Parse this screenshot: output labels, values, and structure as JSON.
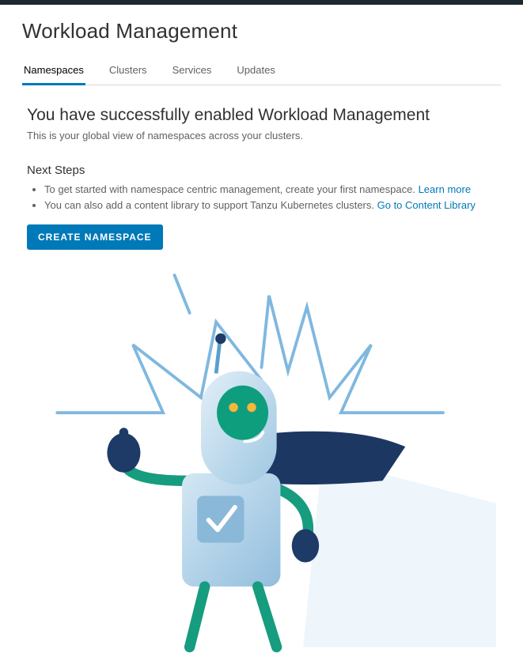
{
  "header": {
    "title": "Workload Management"
  },
  "tabs": [
    {
      "label": "Namespaces",
      "active": true
    },
    {
      "label": "Clusters",
      "active": false
    },
    {
      "label": "Services",
      "active": false
    },
    {
      "label": "Updates",
      "active": false
    }
  ],
  "content": {
    "success_heading": "You have successfully enabled Workload Management",
    "subheading": "This is your global view of namespaces across your clusters.",
    "next_steps_title": "Next Steps",
    "steps": [
      {
        "text": "To get started with namespace centric management, create your first namespace.",
        "link_label": "Learn more"
      },
      {
        "text": "You can also add a content library to support Tanzu Kubernetes clusters.",
        "link_label": "Go to Content Library"
      }
    ],
    "create_button": "CREATE NAMESPACE"
  }
}
